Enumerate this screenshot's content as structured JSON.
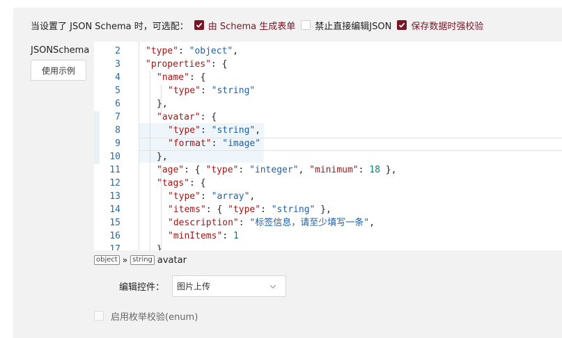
{
  "options": {
    "prefix": "当设置了 JSON Schema 时，可选配：",
    "items": [
      {
        "label": "由 Schema 生成表单",
        "checked": true
      },
      {
        "label": "禁止直接编辑JSON",
        "checked": false
      },
      {
        "label": "保存数据时强校验",
        "checked": true
      }
    ]
  },
  "sidebar": {
    "label": "JSONSchema",
    "example_button": "使用示例"
  },
  "editor": {
    "lines": [
      {
        "no": "2",
        "indent": 1,
        "tokens": [
          [
            "k",
            "\"type\""
          ],
          [
            "p",
            ": "
          ],
          [
            "s",
            "\"object\""
          ],
          [
            "p",
            ","
          ]
        ]
      },
      {
        "no": "3",
        "indent": 1,
        "tokens": [
          [
            "k",
            "\"properties\""
          ],
          [
            "p",
            ": {"
          ]
        ]
      },
      {
        "no": "4",
        "indent": 2,
        "tokens": [
          [
            "k",
            "\"name\""
          ],
          [
            "p",
            ": {"
          ]
        ]
      },
      {
        "no": "5",
        "indent": 3,
        "tokens": [
          [
            "k",
            "\"type\""
          ],
          [
            "p",
            ": "
          ],
          [
            "s",
            "\"string\""
          ]
        ]
      },
      {
        "no": "6",
        "indent": 2,
        "tokens": [
          [
            "p",
            "},"
          ]
        ]
      },
      {
        "no": "7",
        "indent": 2,
        "tokens": [
          [
            "k",
            "\"avatar\""
          ],
          [
            "p",
            ": {"
          ]
        ]
      },
      {
        "no": "8",
        "indent": 3,
        "tokens": [
          [
            "k",
            "\"type\""
          ],
          [
            "p",
            ": "
          ],
          [
            "s",
            "\"string\""
          ],
          [
            "p",
            ","
          ]
        ]
      },
      {
        "no": "9",
        "indent": 3,
        "tokens": [
          [
            "k",
            "\"format\""
          ],
          [
            "p",
            ": "
          ],
          [
            "s",
            "\"image\""
          ]
        ]
      },
      {
        "no": "10",
        "indent": 2,
        "tokens": [
          [
            "p",
            "},"
          ]
        ]
      },
      {
        "no": "11",
        "indent": 2,
        "tokens": [
          [
            "k",
            "\"age\""
          ],
          [
            "p",
            ": { "
          ],
          [
            "k",
            "\"type\""
          ],
          [
            "p",
            ": "
          ],
          [
            "s",
            "\"integer\""
          ],
          [
            "p",
            ", "
          ],
          [
            "k",
            "\"minimum\""
          ],
          [
            "p",
            ": "
          ],
          [
            "n",
            "18"
          ],
          [
            "p",
            " },"
          ]
        ]
      },
      {
        "no": "12",
        "indent": 2,
        "tokens": [
          [
            "k",
            "\"tags\""
          ],
          [
            "p",
            ": {"
          ]
        ]
      },
      {
        "no": "13",
        "indent": 3,
        "tokens": [
          [
            "k",
            "\"type\""
          ],
          [
            "p",
            ": "
          ],
          [
            "s",
            "\"array\""
          ],
          [
            "p",
            ","
          ]
        ]
      },
      {
        "no": "14",
        "indent": 3,
        "tokens": [
          [
            "k",
            "\"items\""
          ],
          [
            "p",
            ": { "
          ],
          [
            "k",
            "\"type\""
          ],
          [
            "p",
            ": "
          ],
          [
            "s",
            "\"string\""
          ],
          [
            "p",
            " },"
          ]
        ]
      },
      {
        "no": "15",
        "indent": 3,
        "tokens": [
          [
            "k",
            "\"description\""
          ],
          [
            "p",
            ": "
          ],
          [
            "s",
            "\"标签信息，请至少填写一条\""
          ],
          [
            "p",
            ","
          ]
        ]
      },
      {
        "no": "16",
        "indent": 3,
        "tokens": [
          [
            "k",
            "\"minItems\""
          ],
          [
            "p",
            ": "
          ],
          [
            "n",
            "1"
          ]
        ]
      },
      {
        "no": "17",
        "indent": 2,
        "tokens": [
          [
            "p",
            "}"
          ]
        ]
      }
    ]
  },
  "breadcrumb": {
    "root_type": "object",
    "separator": "»",
    "leaf_type": "string",
    "current": "avatar"
  },
  "control": {
    "label": "编辑控件：",
    "selected": "图片上传"
  },
  "enum_check": {
    "label": "启用枚举校验(enum)",
    "checked": false
  }
}
